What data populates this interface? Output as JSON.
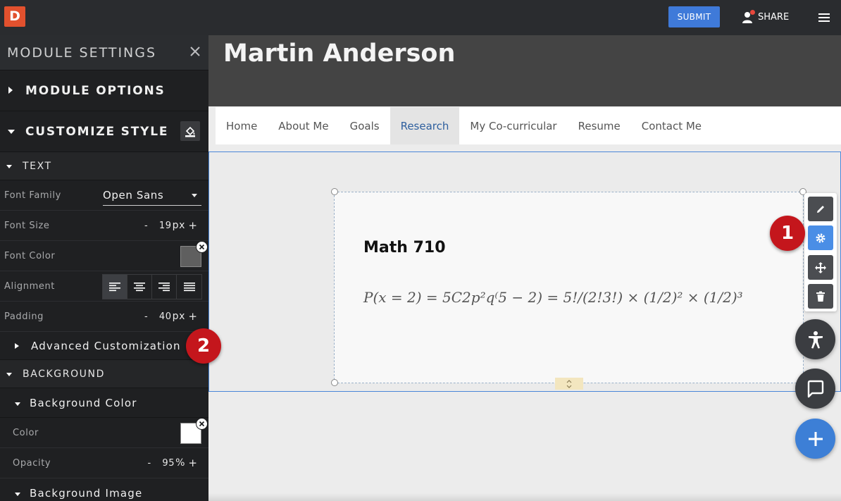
{
  "topbar": {
    "logo_letter": "D",
    "submit_label": "SUBMIT",
    "share_label": "SHARE"
  },
  "sidebar": {
    "title": "MODULE SETTINGS",
    "module_options": "MODULE OPTIONS",
    "customize_style": "CUSTOMIZE STYLE",
    "text_section": "TEXT",
    "font_family": {
      "label": "Font Family",
      "value": "Open Sans"
    },
    "font_size": {
      "label": "Font Size",
      "value": "19",
      "unit": "px"
    },
    "font_color": {
      "label": "Font Color",
      "color": "#5f5f5f"
    },
    "alignment": {
      "label": "Alignment",
      "active": "left"
    },
    "padding": {
      "label": "Padding",
      "value": "40",
      "unit": "px"
    },
    "advanced": "Advanced Customization",
    "background_section": "BACKGROUND",
    "background_color_sub": "Background Color",
    "color": {
      "label": "Color",
      "color": "#ffffff"
    },
    "opacity": {
      "label": "Opacity",
      "value": "95",
      "unit": "%"
    },
    "background_image_sub": "Background Image",
    "minus": "-",
    "plus": "+"
  },
  "site": {
    "title": "Martin Anderson",
    "nav": [
      "Home",
      "About Me",
      "Goals",
      "Research",
      "My Co-curricular",
      "Resume",
      "Contact Me"
    ],
    "active_nav": "Research"
  },
  "module": {
    "heading": "Math 710",
    "formula": "P(x = 2) = 5C2p²q⁽5 − 2) = 5!/(2!3!) × (1/2)² × (1/2)³"
  },
  "badges": {
    "one": "1",
    "two": "2"
  },
  "colors": {
    "accent_blue": "#3f7ad9",
    "logo_orange": "#e2512e",
    "badge_red": "#c4161c"
  }
}
